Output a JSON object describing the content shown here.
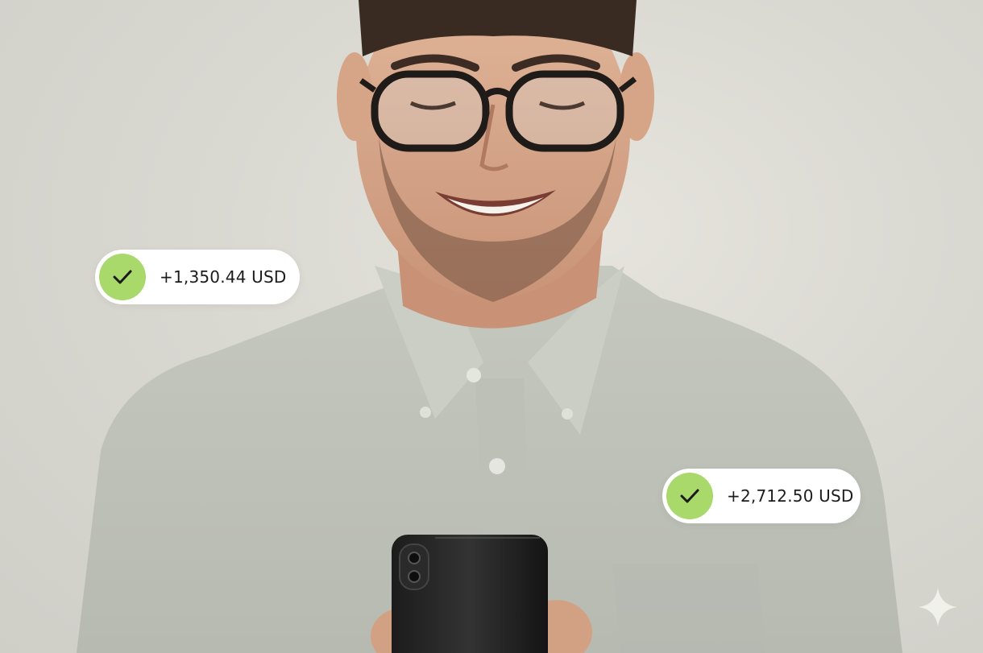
{
  "notifications": [
    {
      "amount": "+1,350.44 USD",
      "icon": "check-icon",
      "status_color": "#a9d96a"
    },
    {
      "amount": "+2,712.50 USD",
      "icon": "check-icon",
      "status_color": "#a9d96a"
    }
  ],
  "photo": {
    "subject": "smiling man with glasses looking at smartphone"
  },
  "watermark": {
    "icon": "sparkle-icon"
  }
}
